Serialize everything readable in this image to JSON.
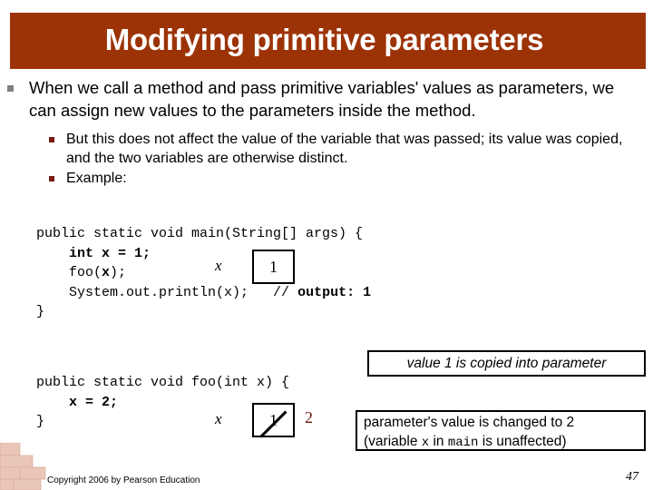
{
  "slide": {
    "title": "Modifying primitive parameters",
    "title_bar_color": "#9c3306",
    "background_color": "#ffffff"
  },
  "outline": {
    "level1": {
      "marker": "square-bullet-gray",
      "marker_color": "#808080",
      "text": "When we call a method and pass primitive variables' values as parameters, we can assign new values to the parameters inside the method."
    },
    "level2": {
      "marker_color": "#7b1a14",
      "items": [
        {
          "marker": "square-bullet-darkred",
          "text": "But this does not affect the value of the variable that was passed; its value was copied, and the two variables are otherwise distinct."
        },
        {
          "marker": "square-bullet-darkred",
          "text": "Example:"
        }
      ]
    }
  },
  "code_block_1": {
    "lines": [
      [
        {
          "t": "public static void main(String[] args) {",
          "b": false
        }
      ],
      [
        {
          "t": "    ",
          "b": false
        },
        {
          "t": "int x = 1;",
          "b": true
        }
      ],
      [
        {
          "t": "    foo(",
          "b": false
        },
        {
          "t": "x",
          "b": true
        },
        {
          "t": ");",
          "b": false
        }
      ],
      [
        {
          "t": "    System.out.println(x);   ",
          "b": false
        },
        {
          "t": "// ",
          "b": false
        },
        {
          "t": "output: 1",
          "b": true
        }
      ],
      [
        {
          "t": "}",
          "b": false
        }
      ]
    ]
  },
  "code_block_2": {
    "lines": [
      [
        {
          "t": "public static void foo(int x) {",
          "b": false
        }
      ],
      [
        {
          "t": "    ",
          "b": false
        },
        {
          "t": "x = 2;",
          "b": true
        }
      ],
      [
        {
          "t": "}",
          "b": false
        }
      ]
    ]
  },
  "variable_box_main": {
    "label": "x",
    "value": "1",
    "struck_out": false
  },
  "variable_box_foo": {
    "label": "x",
    "value": "1",
    "struck_out": true,
    "new_value": "2",
    "new_value_color": "#6d1a10"
  },
  "callouts": {
    "copied": "value 1 is copied into parameter",
    "changed_line1": "parameter's value is changed to 2",
    "changed_line2_prefix": "(variable ",
    "changed_line2_var": "x",
    "changed_line2_mid": " in ",
    "changed_line2_method": "main",
    "changed_line2_suffix": " is unaffected)"
  },
  "footer": {
    "copyright": "Copyright 2006 by Pearson Education",
    "page_number": "47",
    "decor_color": "#e9c6b8"
  }
}
